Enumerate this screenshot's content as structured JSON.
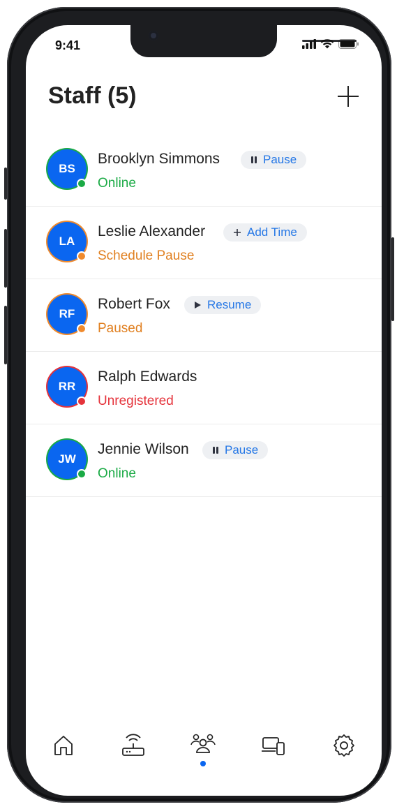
{
  "status_bar": {
    "time": "9:41"
  },
  "header": {
    "title": "Staff (5)"
  },
  "colors": {
    "accent": "#0A66F0",
    "online": "#1AAA45",
    "paused": "#F08A2C",
    "unregistered": "#E5333B",
    "pill_text": "#2577E6",
    "pill_bg": "#EEF0F3"
  },
  "staff": [
    {
      "initials": "BS",
      "name": "Brooklyn Simmons",
      "status": "Online",
      "action": {
        "icon": "pause-icon",
        "label": "Pause"
      }
    },
    {
      "initials": "LA",
      "name": "Leslie Alexander",
      "status": "Schedule Pause",
      "action": {
        "icon": "plus-icon",
        "label": "Add Time"
      }
    },
    {
      "initials": "RF",
      "name": "Robert Fox",
      "status": "Paused",
      "action": {
        "icon": "play-icon",
        "label": "Resume"
      }
    },
    {
      "initials": "RR",
      "name": "Ralph Edwards",
      "status": "Unregistered",
      "action": null
    },
    {
      "initials": "JW",
      "name": "Jennie Wilson",
      "status": "Online",
      "action": {
        "icon": "pause-icon",
        "label": "Pause"
      }
    }
  ],
  "bottom_nav": {
    "items": [
      {
        "icon": "home-icon"
      },
      {
        "icon": "router-icon"
      },
      {
        "icon": "users-icon",
        "active": true
      },
      {
        "icon": "devices-icon"
      },
      {
        "icon": "settings-icon"
      }
    ]
  }
}
